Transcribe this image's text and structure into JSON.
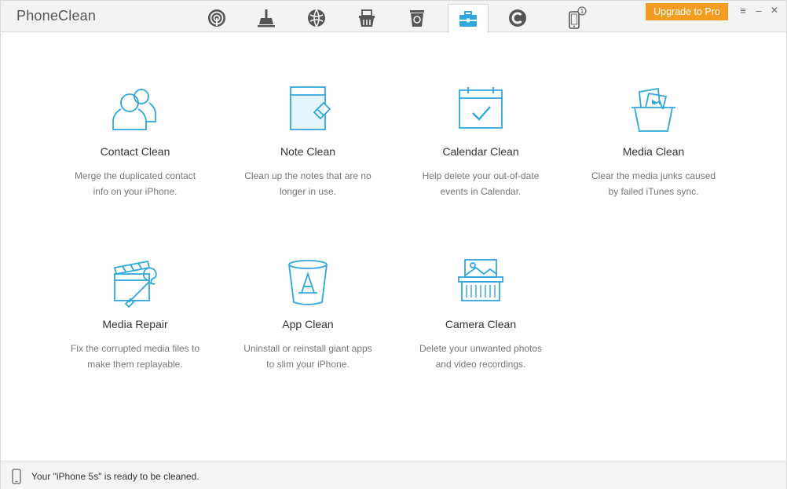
{
  "app": {
    "title": "PhoneClean"
  },
  "toolbar": {
    "tabs": [
      {
        "icon": "quick-clean-icon",
        "active": false
      },
      {
        "icon": "broom-icon",
        "active": false
      },
      {
        "icon": "internet-clean-icon",
        "active": false
      },
      {
        "icon": "junk-basket-icon",
        "active": false
      },
      {
        "icon": "recycle-bin-icon",
        "active": false
      },
      {
        "icon": "toolbox-icon",
        "active": true
      },
      {
        "icon": "privacy-icon",
        "active": false
      },
      {
        "icon": "device-icon",
        "active": false,
        "badge": "1"
      }
    ],
    "upgrade_label": "Upgrade to Pro",
    "menu_glyph": "≡",
    "minimize_glyph": "–",
    "close_glyph": "✕"
  },
  "colors": {
    "accent": "#2fa7dc",
    "upgrade": "#f39c1f",
    "tab_icon": "#555555"
  },
  "tools": [
    {
      "icon": "contact-icon",
      "name": "Contact Clean",
      "desc": "Merge the duplicated contact info on your iPhone."
    },
    {
      "icon": "note-icon",
      "name": "Note Clean",
      "desc": "Clean up the notes that are no longer in use."
    },
    {
      "icon": "calendar-icon",
      "name": "Calendar Clean",
      "desc": "Help delete your out-of-date events in Calendar."
    },
    {
      "icon": "media-basket-icon",
      "name": "Media Clean",
      "desc": "Clear the media junks caused by failed iTunes sync."
    },
    {
      "icon": "media-repair-icon",
      "name": "Media Repair",
      "desc": "Fix the corrupted media files to make them replayable."
    },
    {
      "icon": "app-store-bin-icon",
      "name": "App Clean",
      "desc": "Uninstall or reinstall giant apps to slim your iPhone."
    },
    {
      "icon": "camera-shredder-icon",
      "name": "Camera Clean",
      "desc": "Delete your unwanted photos and video recordings."
    }
  ],
  "status": {
    "message": "Your \"iPhone 5s\" is ready to be cleaned."
  }
}
